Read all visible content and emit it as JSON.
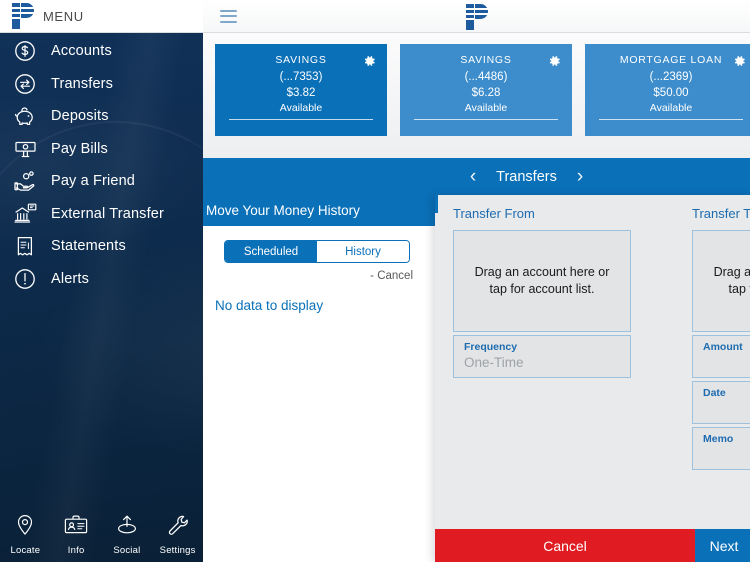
{
  "sidebar": {
    "menu_label": "MENU",
    "items": [
      {
        "label": "Accounts",
        "icon": "dollar-circle-icon"
      },
      {
        "label": "Transfers",
        "icon": "transfer-arrows-circle-icon"
      },
      {
        "label": "Deposits",
        "icon": "piggy-bank-icon"
      },
      {
        "label": "Pay Bills",
        "icon": "banknote-hand-icon"
      },
      {
        "label": "Pay a Friend",
        "icon": "hand-coin-icon"
      },
      {
        "label": "External Transfer",
        "icon": "bank-building-icon"
      },
      {
        "label": "Statements",
        "icon": "receipt-icon"
      },
      {
        "label": "Alerts",
        "icon": "exclamation-circle-icon"
      }
    ],
    "bottom_nav": [
      {
        "label": "Locate",
        "icon": "map-pin-icon"
      },
      {
        "label": "Info",
        "icon": "id-card-icon"
      },
      {
        "label": "Social",
        "icon": "share-upload-icon"
      },
      {
        "label": "Settings",
        "icon": "wrench-icon"
      }
    ]
  },
  "topbar": {
    "hamburger": "hamburger-icon",
    "logo": "pnc-p-logo"
  },
  "cards": [
    {
      "name": "SAVINGS",
      "number": "(...7353)",
      "amount": "$3.82",
      "status": "Available",
      "selected": true
    },
    {
      "name": "SAVINGS",
      "number": "(...4486)",
      "amount": "$6.28",
      "status": "Available",
      "selected": false
    },
    {
      "name": "MORTGAGE LOAN",
      "number": "(...2369)",
      "amount": "$50.00",
      "status": "Available",
      "selected": false
    }
  ],
  "transfers_bar": {
    "prev": "‹",
    "title": "Transfers",
    "next": "›"
  },
  "history": {
    "title": "Move Your Money History",
    "tabs": [
      {
        "label": "Scheduled",
        "active": true
      },
      {
        "label": "History",
        "active": false
      }
    ],
    "cancel_link": "- Cancel",
    "empty_message": "No data to display"
  },
  "modal": {
    "from": {
      "title": "Transfer From",
      "dropzone_text": "Drag an account here or tap for account list.",
      "frequency_label": "Frequency",
      "frequency_value": "One-Time"
    },
    "to": {
      "title": "Transfer To",
      "dropzone_text": "Drag an account here or tap for account list.",
      "amount_label": "Amount",
      "date_label": "Date",
      "memo_label": "Memo"
    },
    "cancel_button": "Cancel",
    "next_button": "Next"
  },
  "colors": {
    "brand_blue": "#0a70b8",
    "card_blue": "#3d8dcc",
    "sidebar_navy": "#0d2b4c",
    "danger_red": "#e01b22"
  }
}
